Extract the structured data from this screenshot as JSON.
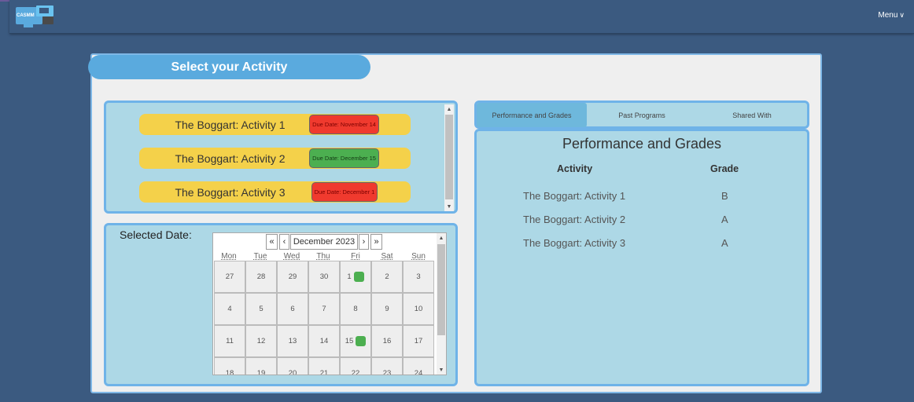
{
  "header": {
    "logo_text": "CASMM",
    "menu_label": "Menu"
  },
  "page": {
    "title": "Select your Activity"
  },
  "activities": [
    {
      "name": "The Boggart: Activity 1",
      "due": "Due Date: November 14",
      "status": "overdue",
      "color": "#f03a2e"
    },
    {
      "name": "The Boggart: Activity 2",
      "due": "Due Date: December 15",
      "status": "upcoming",
      "color": "#4caf50"
    },
    {
      "name": "The Boggart: Activity 3",
      "due": "Due Date: December 1",
      "status": "overdue",
      "color": "#f03a2e"
    }
  ],
  "calendar": {
    "selected_date_label": "Selected Date:",
    "month_label": "December 2023",
    "nav": {
      "prev_year": "«",
      "prev_month": "‹",
      "next_month": "›",
      "next_year": "»"
    },
    "weekdays": [
      "Mon",
      "Tue",
      "Wed",
      "Thu",
      "Fri",
      "Sat",
      "Sun"
    ],
    "weeks": [
      [
        "27",
        "28",
        "29",
        "30",
        "1",
        "2",
        "3"
      ],
      [
        "4",
        "5",
        "6",
        "7",
        "8",
        "9",
        "10"
      ],
      [
        "11",
        "12",
        "13",
        "14",
        "15",
        "16",
        "17"
      ],
      [
        "18",
        "19",
        "20",
        "21",
        "22",
        "23",
        "24"
      ]
    ],
    "marked_days": [
      "1",
      "15"
    ],
    "mark_color": "#4caf50"
  },
  "tabs": [
    {
      "label": "Performance and Grades",
      "active": true
    },
    {
      "label": "Past Programs",
      "active": false
    },
    {
      "label": "Shared With",
      "active": false
    }
  ],
  "grades": {
    "title": "Performance and Grades",
    "columns": {
      "activity": "Activity",
      "grade": "Grade"
    },
    "rows": [
      {
        "activity": "The Boggart: Activity 1",
        "grade": "B"
      },
      {
        "activity": "The Boggart: Activity 2",
        "grade": "A"
      },
      {
        "activity": "The Boggart: Activity 3",
        "grade": "A"
      }
    ]
  },
  "colors": {
    "background": "#3b5a80",
    "accent": "#5aaade",
    "panel": "#add8e6",
    "activity_bar": "#f4d14a"
  },
  "icons": [
    "logo-icon",
    "chevron-down-icon",
    "scroll-up-arrow-icon",
    "scroll-down-arrow-icon"
  ]
}
